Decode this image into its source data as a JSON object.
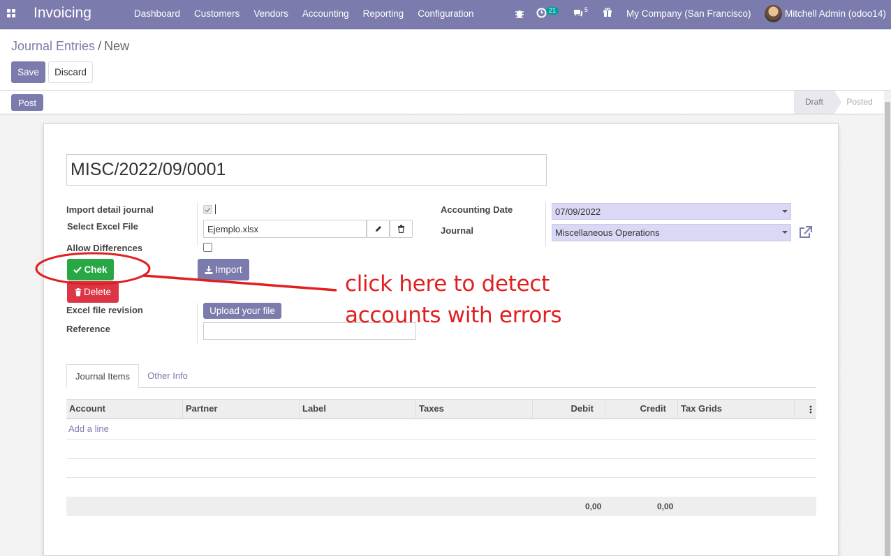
{
  "nav": {
    "app_name": "Invoicing",
    "menu": [
      "Dashboard",
      "Customers",
      "Vendors",
      "Accounting",
      "Reporting",
      "Configuration"
    ],
    "activity_count": "21",
    "messages_count": "5",
    "company": "My Company (San Francisco)",
    "user": "Mitchell Admin (odoo14)"
  },
  "breadcrumb": {
    "parent": "Journal Entries",
    "separator": "/",
    "current": "New"
  },
  "toolbar": {
    "save_label": "Save",
    "discard_label": "Discard"
  },
  "statusbar": {
    "post_label": "Post",
    "states": [
      "Draft",
      "Posted"
    ],
    "active_state": "Draft"
  },
  "form": {
    "name": "MISC/2022/09/0001",
    "import_detail_label": "Import detail journal",
    "select_file_label": "Select Excel File",
    "file_name": "Ejemplo.xlsx",
    "allow_diff_label": "Allow Differences",
    "chek_label": "Chek",
    "delete_label": "Delete",
    "import_label": "Import",
    "revision_label": "Excel file revision",
    "upload_label": "Upload your file",
    "reference_label": "Reference",
    "reference_value": "",
    "date_label": "Accounting Date",
    "date_value": "07/09/2022",
    "journal_label": "Journal",
    "journal_value": "Miscellaneous Operations"
  },
  "annotation": {
    "line1": "click here to detect",
    "line2": "accounts with errors",
    "color": "#e02020"
  },
  "tabs": [
    "Journal Items",
    "Other Info"
  ],
  "table": {
    "columns": [
      "Account",
      "Partner",
      "Label",
      "Taxes",
      "Debit",
      "Credit",
      "Tax Grids"
    ],
    "add_line": "Add a line",
    "total_debit": "0,00",
    "total_credit": "0,00"
  },
  "colors": {
    "brand": "#7c7bad",
    "success": "#28a745",
    "danger": "#dc3545",
    "select_bg": "#d9d8f5"
  }
}
